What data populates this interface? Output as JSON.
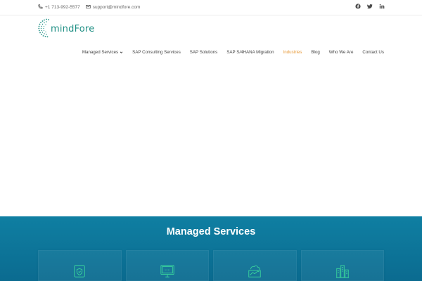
{
  "topbar": {
    "phone": "+1 713-992-5577",
    "email": "support@mindfore.com",
    "social_icons": [
      "facebook-icon",
      "twitter-icon",
      "linkedin-icon"
    ]
  },
  "logo": {
    "text": "mindFore"
  },
  "nav": {
    "items": [
      {
        "label": "Managed Services",
        "has_dropdown": true
      },
      {
        "label": "SAP Consulting Services"
      },
      {
        "label": "SAP Solutions"
      },
      {
        "label": "SAP S/4HANA Migration"
      },
      {
        "label": "Industries",
        "active": true
      },
      {
        "label": "Blog"
      },
      {
        "label": "Who We Are"
      },
      {
        "label": "Contact Us"
      }
    ]
  },
  "services": {
    "title": "Managed Services",
    "card_icons": [
      "shield-monitor-icon",
      "monitor-icon",
      "cloud-chart-icon",
      "city-building-icon"
    ]
  },
  "colors": {
    "accent": "#e79a3a",
    "brand": "#1f8f84",
    "section_bg": "#0f7fa2",
    "icon_green": "#39d39c"
  }
}
